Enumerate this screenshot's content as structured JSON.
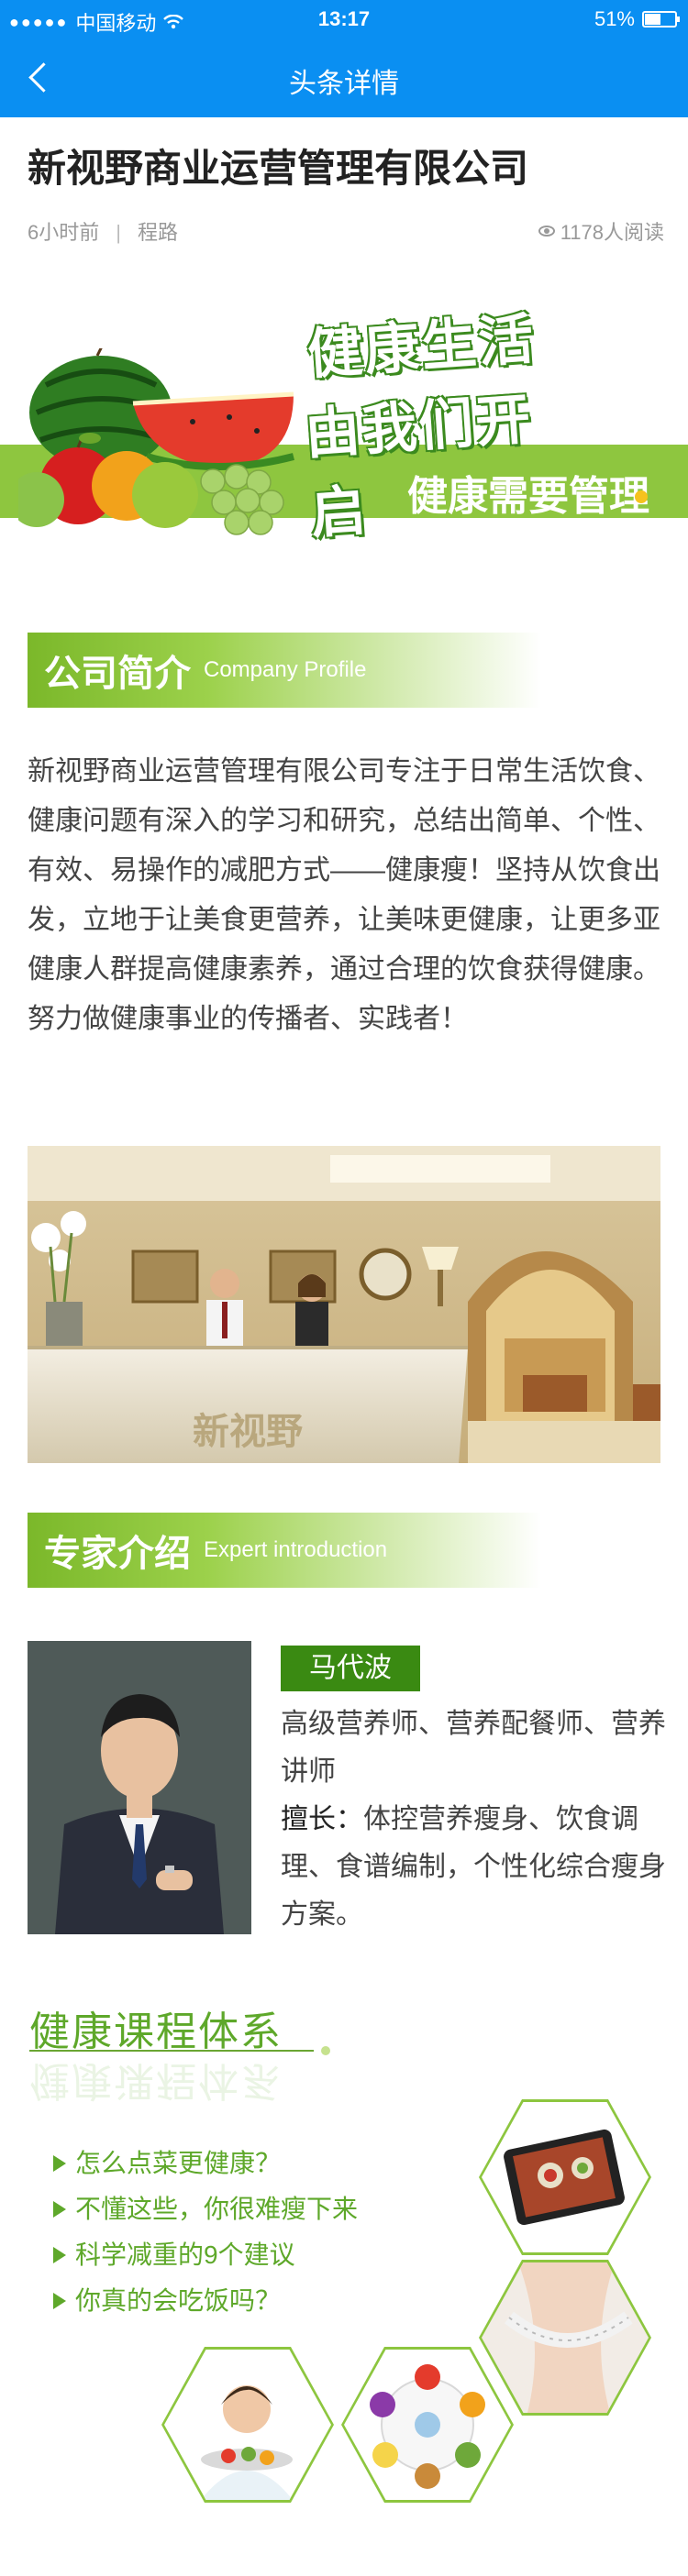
{
  "status_bar": {
    "signal": "●●●●●",
    "carrier": "中国移动",
    "time": "13:17",
    "battery": "51%"
  },
  "nav": {
    "title": "头条详情"
  },
  "article": {
    "title": "新视野商业运营管理有限公司",
    "time_ago": "6小时前",
    "separator": "|",
    "author": "程路",
    "read_count": "1178人阅读"
  },
  "banner": {
    "slogan_line1": "健康生活",
    "slogan_line2": "由我们开启",
    "tagline": "健康需要管理"
  },
  "company_section": {
    "title_cn": "公司简介",
    "title_en": "Company Profile",
    "paragraph": "新视野商业运营管理有限公司专注于日常生活饮食、健康问题有深入的学习和研究，总结出简单、个性、有效、易操作的减肥方式——健康瘦！坚持从饮食出发，立地于让美食更营养，让美味更健康，让更多亚健康人群提高健康素养，通过合理的饮食获得健康。努力做健康事业的传播者、实践者！"
  },
  "photo": {
    "desk_sign": "新视野"
  },
  "expert_section": {
    "title_cn": "专家介绍",
    "title_en": "Expert introduction",
    "name": "马代波",
    "roles": "高级营养师、营养配餐师、营养讲师",
    "specialty_label": "擅长：",
    "specialty": "体控营养瘦身、饮食调理、食谱编制，个性化综合瘦身方案。"
  },
  "course_section": {
    "title": "健康课程体系",
    "items": [
      "怎么点菜更健康？",
      "不懂这些，你很难瘦下来",
      "科学减重的9个建议",
      "你真的会吃饭吗？"
    ]
  },
  "colors": {
    "nav_blue": "#0a8ff2",
    "accent_green": "#8ec63f",
    "dark_green": "#3a8a12"
  }
}
